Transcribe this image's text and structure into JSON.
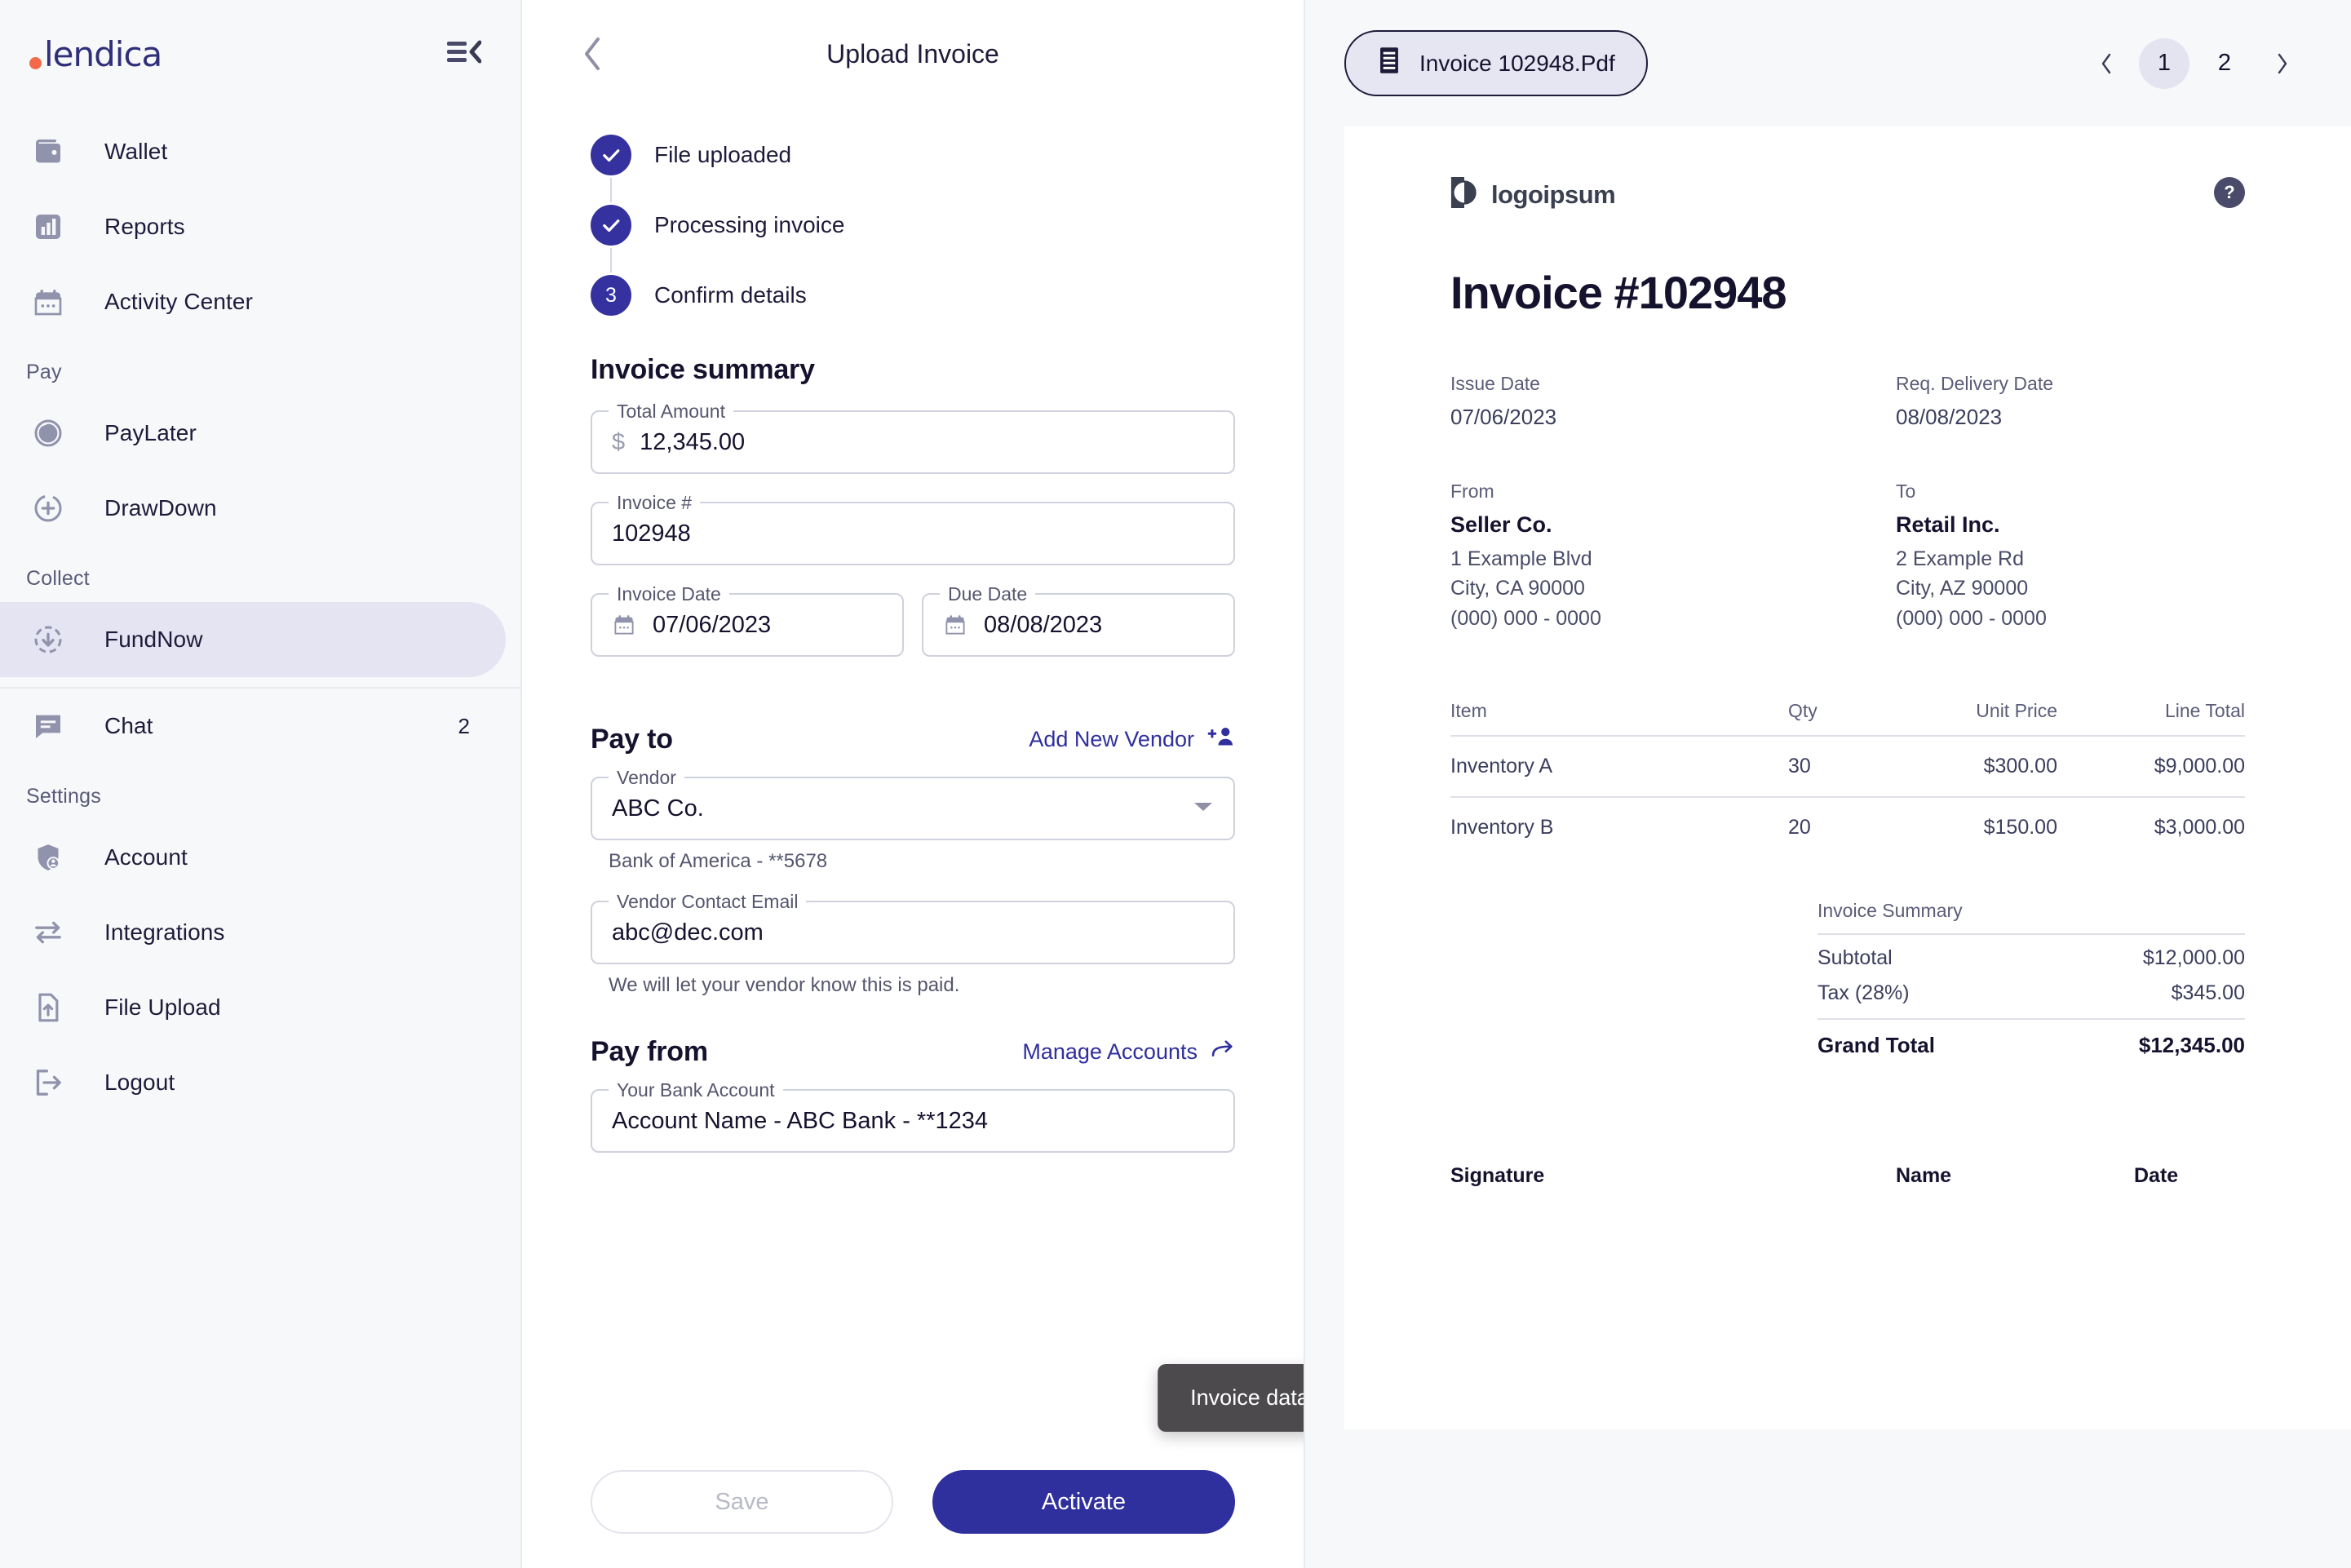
{
  "brand": {
    "name": "lendica",
    "dot_color": "#f26a4b",
    "text_color": "#2f2f7a",
    "accent": "#2f2f9e"
  },
  "sidebar": {
    "collapse_icon": "menu-collapse-icon",
    "groups": [
      {
        "label": "",
        "items": [
          {
            "label": "Wallet",
            "icon": "wallet-icon",
            "badge": "",
            "active": false
          },
          {
            "label": "Reports",
            "icon": "reports-bar-chart-icon",
            "badge": "",
            "active": false
          },
          {
            "label": "Activity Center",
            "icon": "calendar-icon",
            "badge": "",
            "active": false
          }
        ]
      },
      {
        "label": "Pay",
        "items": [
          {
            "label": "PayLater",
            "icon": "clock-pie-icon",
            "badge": "",
            "active": false
          },
          {
            "label": "DrawDown",
            "icon": "circle-plus-icon",
            "badge": "",
            "active": false
          }
        ]
      },
      {
        "label": "Collect",
        "items": [
          {
            "label": "FundNow",
            "icon": "circle-arrow-down-icon",
            "badge": "",
            "active": true
          }
        ]
      },
      {
        "label": "",
        "items": [
          {
            "label": "Chat",
            "icon": "chat-bubble-icon",
            "badge": "2",
            "active": false
          }
        ]
      },
      {
        "label": "Settings",
        "items": [
          {
            "label": "Account",
            "icon": "shield-user-icon",
            "badge": "",
            "active": false
          },
          {
            "label": "Integrations",
            "icon": "exchange-arrows-icon",
            "badge": "",
            "active": false
          },
          {
            "label": "File Upload",
            "icon": "file-upload-icon",
            "badge": "",
            "active": false
          },
          {
            "label": "Logout",
            "icon": "logout-icon",
            "badge": "",
            "active": false
          }
        ]
      }
    ]
  },
  "middle": {
    "back_icon": "chevron-left-icon",
    "title": "Upload Invoice",
    "steps": [
      {
        "marker": "check",
        "label": "File uploaded"
      },
      {
        "marker": "check",
        "label": "Processing invoice"
      },
      {
        "marker": "3",
        "label": "Confirm details"
      }
    ],
    "invoice_summary": {
      "title": "Invoice summary",
      "total_amount": {
        "label": "Total Amount",
        "prefix": "$",
        "value": "12,345.00"
      },
      "invoice_number": {
        "label": "Invoice #",
        "value": "102948"
      },
      "invoice_date": {
        "label": "Invoice Date",
        "value": "07/06/2023"
      },
      "due_date": {
        "label": "Due Date",
        "value": "08/08/2023"
      }
    },
    "pay_to": {
      "title": "Pay to",
      "action_label": "Add New Vendor",
      "action_icon": "add-person-icon",
      "vendor": {
        "label": "Vendor",
        "value": "ABC Co."
      },
      "vendor_bank": "Bank of America - **5678",
      "vendor_email": {
        "label": "Vendor Contact Email",
        "value": "abc@dec.com"
      },
      "email_helper": "We will let your vendor know this is paid."
    },
    "pay_from": {
      "title": "Pay from",
      "action_label": "Manage Accounts",
      "action_icon": "arrow-forward-icon",
      "bank_account": {
        "label": "Your Bank Account",
        "value": "Account Name - ABC Bank - **1234"
      }
    },
    "toast": "Invoice data extracted!",
    "buttons": {
      "save": "Save",
      "activate": "Activate"
    }
  },
  "right": {
    "file_chip": {
      "label": "Invoice 102948.Pdf",
      "icon": "document-icon"
    },
    "pager": {
      "prev_icon": "chevron-left-icon",
      "next_icon": "chevron-right-icon",
      "pages": [
        "1",
        "2"
      ],
      "current": "1"
    },
    "document": {
      "logo_name": "logoipsum",
      "help_icon": "question-mark-icon",
      "heading": "Invoice #102948",
      "meta": [
        {
          "label": "Issue Date",
          "value": "07/06/2023"
        },
        {
          "label": "Req. Delivery Date",
          "value": "08/08/2023"
        }
      ],
      "parties": [
        {
          "label": "From",
          "name": "Seller Co.",
          "lines": [
            "1 Example Blvd",
            "City, CA 90000",
            "(000) 000 - 0000"
          ]
        },
        {
          "label": "To",
          "name": "Retail Inc.",
          "lines": [
            "2 Example Rd",
            "City, AZ 90000",
            "(000) 000 - 0000"
          ]
        }
      ],
      "table": {
        "headers": [
          "Item",
          "Qty",
          "Unit Price",
          "Line Total"
        ],
        "rows": [
          {
            "item": "Inventory A",
            "qty": "30",
            "price": "$300.00",
            "total": "$9,000.00"
          },
          {
            "item": "Inventory B",
            "qty": "20",
            "price": "$150.00",
            "total": "$3,000.00"
          }
        ]
      },
      "summary": {
        "title": "Invoice Summary",
        "rows": [
          {
            "label": "Subtotal",
            "value": "$12,000.00"
          },
          {
            "label": "Tax (28%)",
            "value": "$345.00"
          }
        ],
        "total": {
          "label": "Grand Total",
          "value": "$12,345.00"
        }
      },
      "signature_row": [
        "Signature",
        "Name",
        "Date"
      ]
    }
  }
}
